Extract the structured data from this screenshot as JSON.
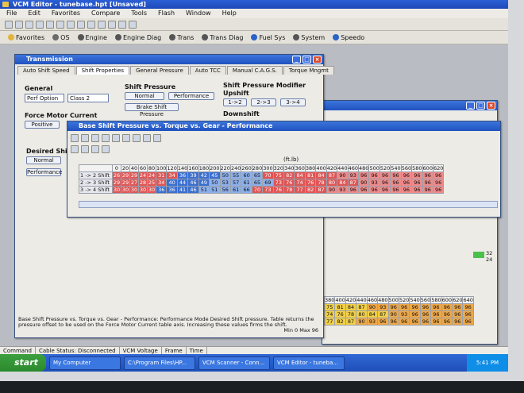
{
  "app": {
    "title": "VCM Editor - tunebase.hpt   [Unsaved]"
  },
  "menu": [
    "File",
    "Edit",
    "Favorites",
    "Compare",
    "Tools",
    "Flash",
    "Window",
    "Help"
  ],
  "toolbar2": [
    {
      "label": "Favorites",
      "icon": "star-icon"
    },
    {
      "label": "OS",
      "icon": "chip-icon"
    },
    {
      "label": "Engine",
      "icon": "gear-icon"
    },
    {
      "label": "Engine Diag",
      "icon": "gear-icon"
    },
    {
      "label": "Trans",
      "icon": "gears-icon"
    },
    {
      "label": "Trans Diag",
      "icon": "gears-icon"
    },
    {
      "label": "Fuel Sys",
      "icon": "pump-icon"
    },
    {
      "label": "System",
      "icon": "gear-icon"
    },
    {
      "label": "Speedo",
      "icon": "speedo-icon"
    }
  ],
  "transmission": {
    "title": "Transmission",
    "tabs": [
      "Auto Shift Speed",
      "Shift Properties",
      "General Pressure",
      "Auto TCC",
      "Manual C.A.G.S.",
      "Torque Mngmt"
    ],
    "general": {
      "label": "General",
      "sel1": "Perf Option",
      "sel2": "Class 2"
    },
    "shift_pressure": {
      "label": "Shift Pressure",
      "normal": "Normal",
      "performance": "Performance",
      "brake": "Brake Shift Pressure"
    },
    "modifier": {
      "label": "Shift Pressure Modifier",
      "upshift": "Upshift",
      "b1": "1->2",
      "b2": "2->3",
      "b3": "3->4",
      "downshift": "Downshift"
    },
    "force": {
      "label": "Force Motor Current",
      "positive": "Positive"
    },
    "desired": {
      "label": "Desired Shift",
      "normal": "Normal",
      "performance": "Performance"
    },
    "description": "Base Shift Pressure vs. Torque vs. Gear - Performance: Performance Mode Desired Shift pressure. Table returns the pressure offset to be used on the Force Motor Current table axis. Increasing these values firms the shift.",
    "desc_right": "Min 0 Max 96"
  },
  "table": {
    "title": "Base Shift Pressure vs. Torque vs. Gear - Performance",
    "unit": "(ft.lb)",
    "cols": [
      "0",
      "20",
      "40",
      "60",
      "80",
      "100",
      "120",
      "140",
      "160",
      "180",
      "200",
      "220",
      "240",
      "260",
      "280",
      "300",
      "320",
      "340",
      "360",
      "380",
      "400",
      "420",
      "440",
      "460",
      "480",
      "500",
      "520",
      "540",
      "560",
      "580",
      "600",
      "620"
    ],
    "rows": [
      {
        "label": "1 -> 2 Shift",
        "values": [
          "26",
          "29",
          "29",
          "24",
          "24",
          "31",
          "34",
          "36",
          "39",
          "42",
          "45",
          "50",
          "55",
          "60",
          "65",
          "70",
          "75",
          "82",
          "84",
          "81",
          "84",
          "87",
          "90",
          "93",
          "96",
          "96",
          "96",
          "96",
          "96",
          "96",
          "96",
          "96"
        ]
      },
      {
        "label": "2 -> 3 Shift",
        "values": [
          "29",
          "29",
          "27",
          "28",
          "25",
          "34",
          "40",
          "44",
          "46",
          "49",
          "50",
          "53",
          "57",
          "61",
          "65",
          "69",
          "73",
          "76",
          "74",
          "76",
          "78",
          "80",
          "84",
          "87",
          "90",
          "93",
          "96",
          "96",
          "96",
          "96",
          "96",
          "96"
        ]
      },
      {
        "label": "3 -> 4 Shift",
        "values": [
          "30",
          "30",
          "30",
          "30",
          "30",
          "36",
          "36",
          "41",
          "46",
          "51",
          "51",
          "56",
          "61",
          "66",
          "70",
          "73",
          "76",
          "78",
          "77",
          "82",
          "87",
          "90",
          "93",
          "96",
          "96",
          "96",
          "96",
          "96",
          "96",
          "96",
          "96",
          "96"
        ]
      }
    ]
  },
  "behind_table": {
    "cols": [
      "380",
      "400",
      "420",
      "440",
      "460",
      "480",
      "500",
      "520",
      "540",
      "560",
      "580",
      "600",
      "620",
      "640"
    ],
    "rows": [
      [
        "75",
        "81",
        "84",
        "87",
        "90",
        "93",
        "96",
        "96",
        "96",
        "96",
        "96",
        "96",
        "96",
        "96"
      ],
      [
        "74",
        "76",
        "78",
        "80",
        "84",
        "87",
        "90",
        "93",
        "96",
        "96",
        "96",
        "96",
        "96",
        "96"
      ],
      [
        "77",
        "82",
        "87",
        "90",
        "93",
        "96",
        "96",
        "96",
        "96",
        "96",
        "96",
        "96",
        "96",
        "96"
      ]
    ],
    "side": [
      "32",
      "24"
    ]
  },
  "statusbar": [
    "Command",
    "Cable Status: Disconnected",
    "VCM Voltage",
    "Frame",
    "Time"
  ],
  "taskbar": {
    "start": "start",
    "tasks": [
      "My Computer",
      "C:\\Program Files\\HP...",
      "VCM Scanner - Conn...",
      "VCM Editor - tuneba..."
    ],
    "clock": "5:41 PM"
  }
}
